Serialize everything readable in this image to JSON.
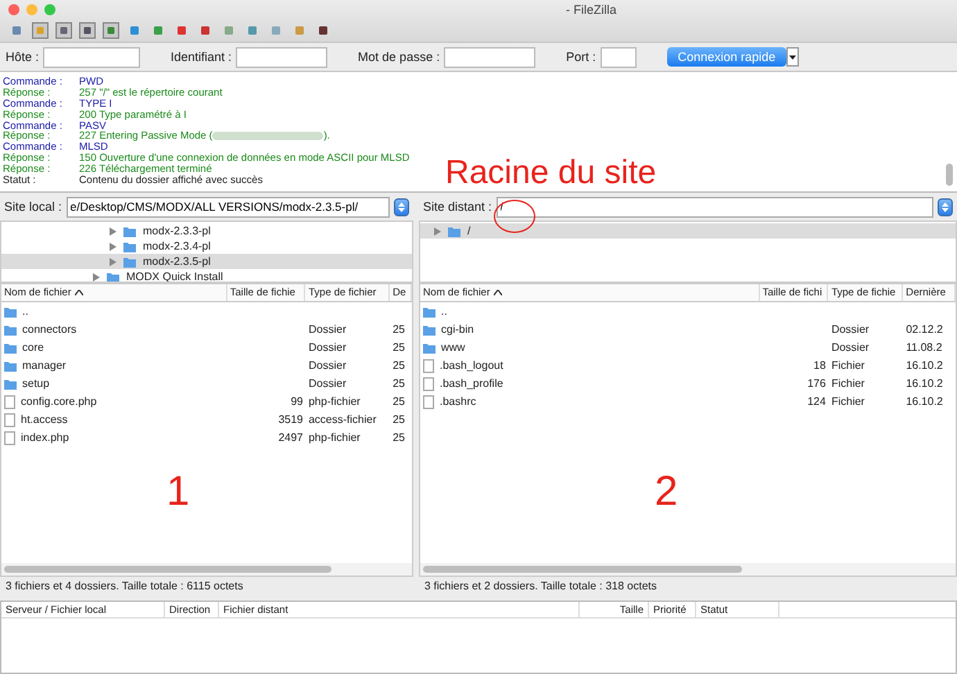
{
  "window": {
    "title": "- FileZilla"
  },
  "quickconnect": {
    "fields": [
      {
        "label": "Hôte :"
      },
      {
        "label": "Identifiant :"
      },
      {
        "label": "Mot de passe :"
      },
      {
        "label": "Port :"
      }
    ],
    "button": "Connexion rapide"
  },
  "log": [
    {
      "kind": "command",
      "label": "Commande :",
      "message": "PWD"
    },
    {
      "kind": "response",
      "label": "Réponse :",
      "message": "257 \"/\" est le répertoire courant"
    },
    {
      "kind": "command",
      "label": "Commande :",
      "message": "TYPE I"
    },
    {
      "kind": "response",
      "label": "Réponse :",
      "message": "200 Type paramétré à I"
    },
    {
      "kind": "command",
      "label": "Commande :",
      "message": "PASV"
    },
    {
      "kind": "response",
      "label": "Réponse :",
      "message": "227 Entering Passive Mode (",
      "after": ")."
    },
    {
      "kind": "command",
      "label": "Commande :",
      "message": "MLSD"
    },
    {
      "kind": "response",
      "label": "Réponse :",
      "message": "150 Ouverture d'une connexion de données en mode ASCII pour MLSD"
    },
    {
      "kind": "response",
      "label": "Réponse :",
      "message": "226 Téléchargement terminé"
    },
    {
      "kind": "status",
      "label": "Statut :",
      "message": "Contenu du dossier affiché avec succès"
    }
  ],
  "annotations": [
    {
      "kind": "caption",
      "text": "Racine du site"
    },
    {
      "kind": "circle"
    },
    {
      "kind": "number",
      "text": "1"
    },
    {
      "kind": "number",
      "text": "2"
    }
  ],
  "local": {
    "label": "Site local :",
    "path": "e/Desktop/CMS/MODX/ALL VERSIONS/modx-2.3.5-pl/",
    "tree": [
      {
        "kind": "nested",
        "name": "modx-2.3.3-pl",
        "selected": false
      },
      {
        "kind": "nested",
        "name": "modx-2.3.4-pl",
        "selected": false
      },
      {
        "kind": "nested",
        "name": "modx-2.3.5-pl",
        "selected": true
      },
      {
        "kind": "top",
        "name": "MODX Quick Install",
        "selected": false
      }
    ],
    "columns": [
      "Nom de fichier",
      "Taille de fichie",
      "Type de fichier",
      "De"
    ],
    "rows": [
      {
        "kind": "folder",
        "name": "..",
        "size": "",
        "type": "",
        "date": ""
      },
      {
        "kind": "folder",
        "name": "connectors",
        "size": "",
        "type": "Dossier",
        "date": "25"
      },
      {
        "kind": "folder",
        "name": "core",
        "size": "",
        "type": "Dossier",
        "date": "25"
      },
      {
        "kind": "folder",
        "name": "manager",
        "size": "",
        "type": "Dossier",
        "date": "25"
      },
      {
        "kind": "folder",
        "name": "setup",
        "size": "",
        "type": "Dossier",
        "date": "25"
      },
      {
        "kind": "file",
        "name": "config.core.php",
        "size": "99",
        "type": "php-fichier",
        "date": "25"
      },
      {
        "kind": "file",
        "name": "ht.access",
        "size": "3519",
        "type": "access-fichier",
        "date": "25"
      },
      {
        "kind": "file",
        "name": "index.php",
        "size": "2497",
        "type": "php-fichier",
        "date": "25"
      }
    ],
    "status": "3 fichiers et 4 dossiers. Taille totale : 6115 octets"
  },
  "remote": {
    "label": "Site distant :",
    "path": "/",
    "tree": [
      {
        "kind": "top",
        "name": "/",
        "selected": true
      }
    ],
    "columns": [
      "Nom de fichier",
      "Taille de fichi",
      "Type de fichie",
      "Dernière"
    ],
    "rows": [
      {
        "kind": "folder",
        "name": "..",
        "size": "",
        "type": "",
        "date": ""
      },
      {
        "kind": "folder",
        "name": "cgi-bin",
        "size": "",
        "type": "Dossier",
        "date": "02.12.2"
      },
      {
        "kind": "folder",
        "name": "www",
        "size": "",
        "type": "Dossier",
        "date": "11.08.2"
      },
      {
        "kind": "file",
        "name": ".bash_logout",
        "size": "18",
        "type": "Fichier",
        "date": "16.10.2"
      },
      {
        "kind": "file",
        "name": ".bash_profile",
        "size": "176",
        "type": "Fichier",
        "date": "16.10.2"
      },
      {
        "kind": "file",
        "name": ".bashrc",
        "size": "124",
        "type": "Fichier",
        "date": "16.10.2"
      }
    ],
    "status": "3 fichiers et 2 dossiers. Taille totale : 318 octets"
  },
  "queue": {
    "columns": [
      "Serveur / Fichier local",
      "Direction",
      "Fichier distant",
      "Taille",
      "Priorité",
      "Statut"
    ]
  }
}
